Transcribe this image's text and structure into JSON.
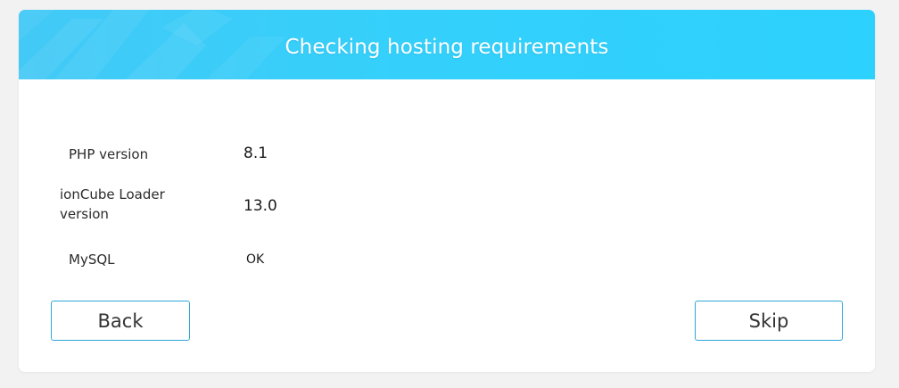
{
  "header": {
    "title": "Checking hosting requirements"
  },
  "requirements": [
    {
      "label": "PHP version",
      "value": "8.1"
    },
    {
      "label": "ionCube Loader version",
      "value": "13.0"
    },
    {
      "label": "MySQL",
      "value": "OK"
    }
  ],
  "buttons": {
    "back_label": "Back",
    "skip_label": "Skip"
  },
  "colors": {
    "header_bg": "#34d0fb",
    "button_border": "#2ea7d9",
    "page_bg": "#f2f2f2"
  }
}
